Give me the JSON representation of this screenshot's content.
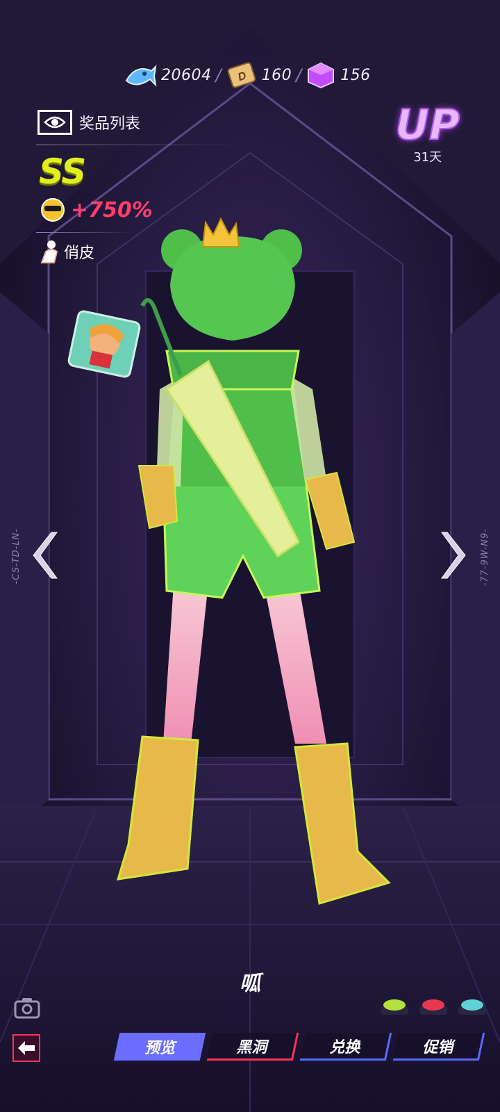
{
  "currencies": [
    {
      "name": "fish",
      "value": "20604",
      "icon": "fish-icon",
      "color": "#5fb7ff"
    },
    {
      "name": "d-card",
      "value": "160",
      "icon": "d-card-icon",
      "color": "#e9c27a"
    },
    {
      "name": "gem-cube",
      "value": "156",
      "icon": "purple-cube-icon",
      "color": "#c24dff"
    }
  ],
  "prize_list_label": "奖品列表",
  "grade": "SS",
  "bonus": "+750%",
  "tag_label": "俏皮",
  "up_badge": {
    "text": "UP",
    "days": "31天"
  },
  "side_codes": {
    "left": "-CS-TD-LN-",
    "right": "-77-9W-N9-"
  },
  "skin_name": "呱",
  "tabs": [
    {
      "label": "预览",
      "active": true
    },
    {
      "label": "黑洞",
      "active": false
    },
    {
      "label": "兑换",
      "active": false
    },
    {
      "label": "促销",
      "active": false
    }
  ],
  "color_swatches": [
    "#b4e23c",
    "#e8384f",
    "#5ed2d6"
  ],
  "accent_colors": {
    "red": "#ff3259",
    "blue": "#6b6dff",
    "yellow": "#e2ef1e",
    "pink": "#ff3d6f"
  }
}
